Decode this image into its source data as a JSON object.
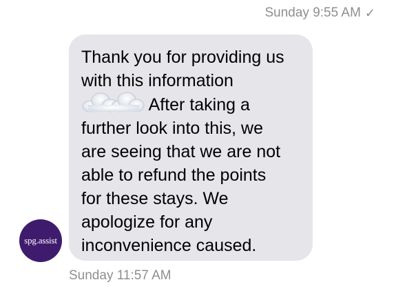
{
  "header": {
    "timestamp": "Sunday 9:55 AM",
    "delivered_icon": "check-icon",
    "delivered_glyph": "✓"
  },
  "message": {
    "lines": [
      "Thank you for providing us",
      "with this information",
      "After taking a",
      "further look into this, we",
      "are seeing that we are not",
      "able to refund the points",
      "for these stays. We",
      "apologize for any",
      "inconvenience caused."
    ],
    "redaction_icon": "cloud-redaction-icon",
    "bubble_color": "#e5e5ea"
  },
  "footer": {
    "timestamp": "Sunday 11:57 AM"
  },
  "sender": {
    "avatar_text": "spg.assist",
    "avatar_color": "#3f1b6e"
  }
}
